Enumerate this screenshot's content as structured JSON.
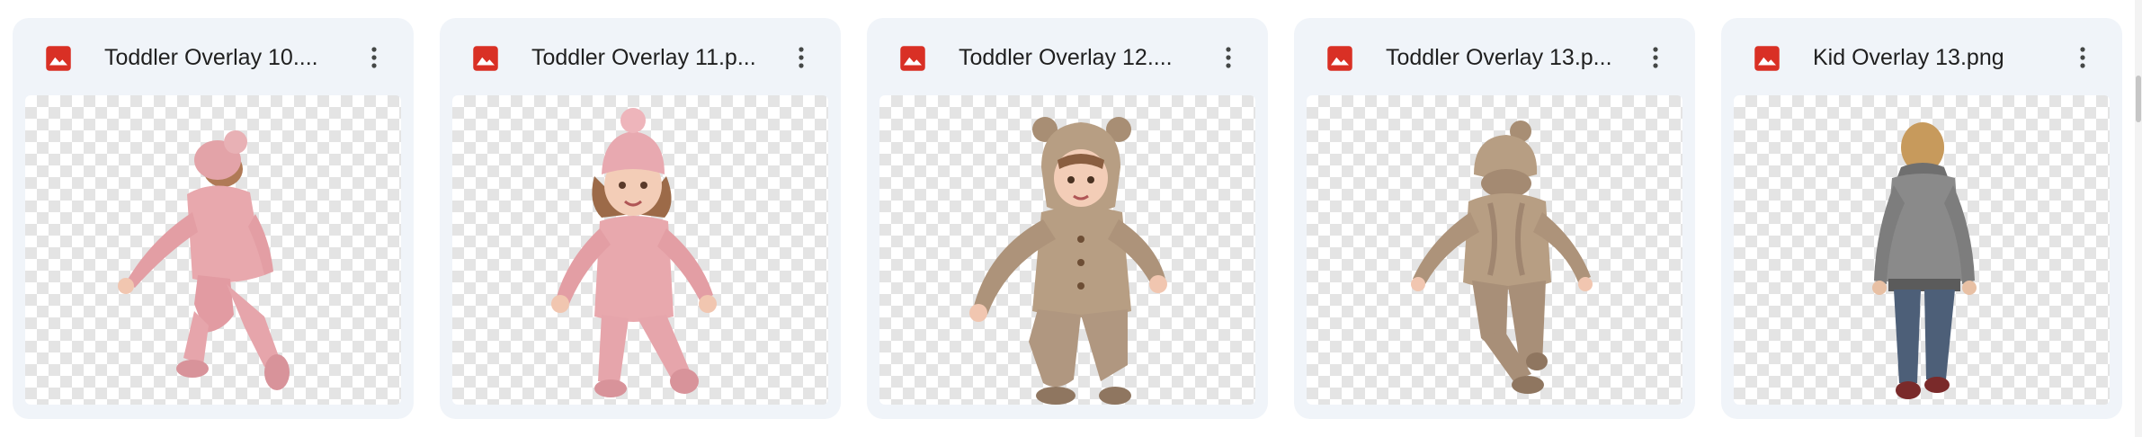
{
  "files": [
    {
      "title": "Toddler Overlay 10....",
      "icon": "image-file-icon",
      "menu_icon": "more-vert-icon",
      "preview": "toddler-pink-back-view"
    },
    {
      "title": "Toddler Overlay 11.p...",
      "icon": "image-file-icon",
      "menu_icon": "more-vert-icon",
      "preview": "toddler-pink-front-hat"
    },
    {
      "title": "Toddler Overlay 12....",
      "icon": "image-file-icon",
      "menu_icon": "more-vert-icon",
      "preview": "toddler-beige-bear-hood"
    },
    {
      "title": "Toddler Overlay 13.p...",
      "icon": "image-file-icon",
      "menu_icon": "more-vert-icon",
      "preview": "toddler-beige-back-view"
    },
    {
      "title": "Kid Overlay 13.png",
      "icon": "image-file-icon",
      "menu_icon": "more-vert-icon",
      "preview": "kid-grey-hoodie-back"
    }
  ],
  "colors": {
    "card_bg": "#f0f4f9",
    "image_icon_red": "#d93025",
    "title_text": "#1f1f1f",
    "pink_knit": "#e8a8ad",
    "beige_knit": "#b79e83",
    "grey_hoodie": "#8a8a8a",
    "jeans": "#4d5f78"
  }
}
